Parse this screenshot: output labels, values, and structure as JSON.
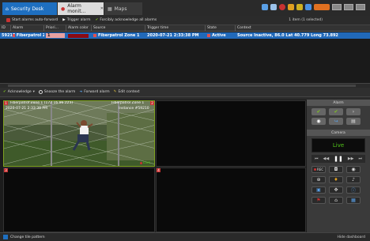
{
  "tabs": [
    {
      "label": "Security Desk",
      "icon": "home-icon"
    },
    {
      "label": "Alarm monit...",
      "icon": "alarm-bell-icon"
    },
    {
      "label": "Maps",
      "icon": "map-icon"
    }
  ],
  "toolbar": {
    "auto_forward": "Start alarms auto-forward",
    "trigger": "Trigger alarm",
    "forcibly_ack": "Forcibly acknowledge all alarms",
    "status": "1 item (1 selected)"
  },
  "table": {
    "headers": [
      "ID",
      "Alarm",
      "Priori...",
      "Alarm color",
      "Source",
      "Trigger time",
      "State",
      "Context"
    ],
    "row": {
      "id": "59210",
      "alarm": "Fiberpatrol Zone 1",
      "priority": "1",
      "source": "Fiberpatrol Zone 1",
      "trigger_time": "2020-07-21 2:33:38 PM",
      "state": "Active",
      "context": "Source Inactive, 86.0 Lat 40.779 Long  73.892"
    }
  },
  "actions": {
    "acknowledge": "Acknowledge",
    "snooze": "Snooze the alarm",
    "forward": "Forward alarm",
    "edit": "Edit context"
  },
  "tile1": {
    "num": "1",
    "title": "Fiberpatrol Zone 1 (172.16.96.223)",
    "time": "2020-07-21 2:33:38 PM",
    "right_title": "Fiberpatrol Zone 1",
    "right_num": "2",
    "instance": "Instance #59210",
    "live": "Live"
  },
  "tile3": {
    "num": "3"
  },
  "tile4": {
    "num": "4"
  },
  "right_panel": {
    "alarm_head": "Alarm",
    "camera_head": "Camera",
    "live": "Live",
    "rec": "REC"
  },
  "bottom": {
    "change_tile": "Change tile pattern",
    "hide": "Hide dashboard"
  },
  "colors": {
    "accent": "#2169b9",
    "alarm_red": "#c83232",
    "live_green": "#52c41a",
    "selection": "#7fa321"
  }
}
